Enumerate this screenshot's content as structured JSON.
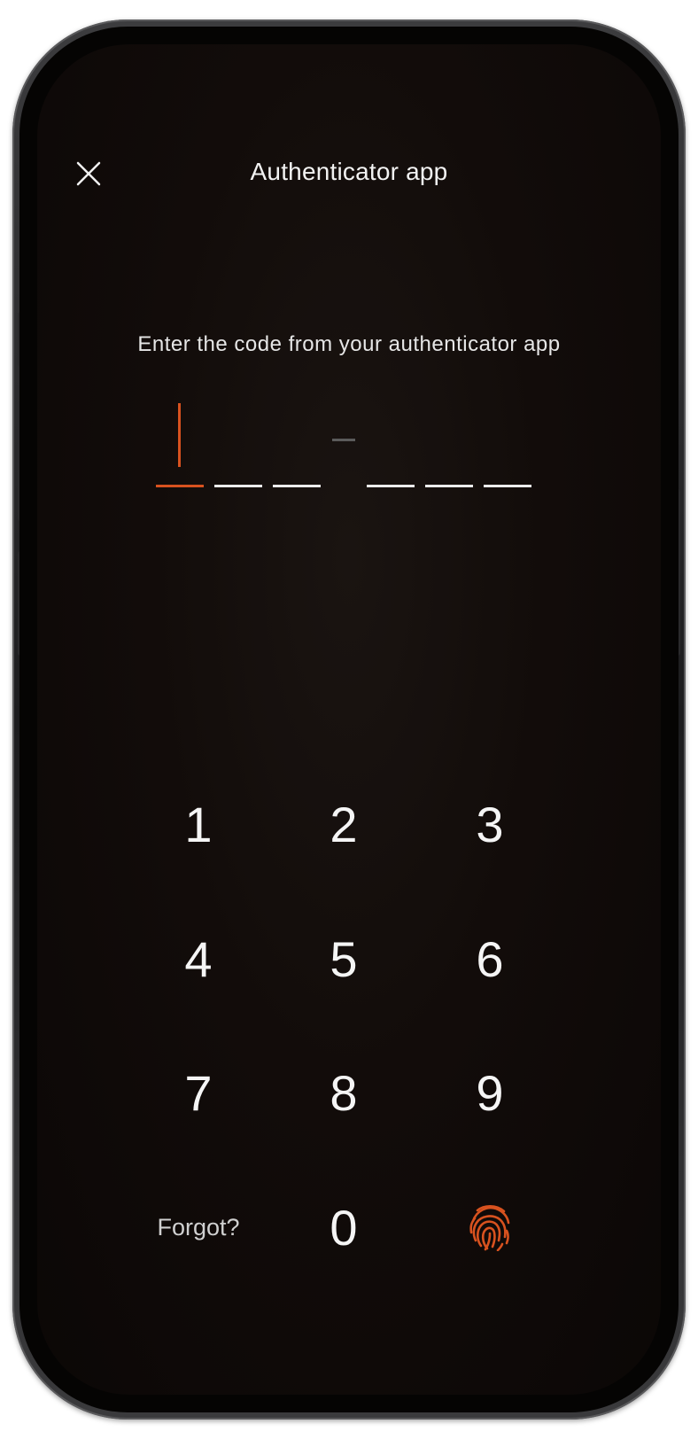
{
  "header": {
    "title": "Authenticator app",
    "close_icon": "close-icon"
  },
  "prompt": "Enter the code from your authenticator app",
  "code_input": {
    "length": 6,
    "filled": 0,
    "active_index": 0,
    "separator": "-"
  },
  "keypad": {
    "keys": [
      "1",
      "2",
      "3",
      "4",
      "5",
      "6",
      "7",
      "8",
      "9"
    ],
    "zero": "0",
    "forgot_label": "Forgot?",
    "biometric_icon": "fingerprint-icon"
  },
  "colors": {
    "accent": "#d8521f",
    "background": "#120c0a",
    "text": "#f2f2f2"
  }
}
